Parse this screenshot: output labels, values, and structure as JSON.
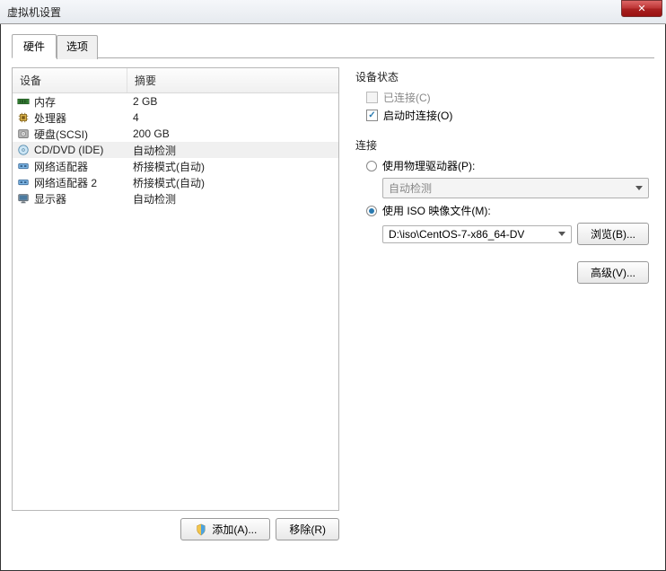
{
  "window": {
    "title": "虚拟机设置",
    "close_glyph": "✕"
  },
  "tabs": [
    {
      "label": "硬件",
      "active": true
    },
    {
      "label": "选项",
      "active": false
    }
  ],
  "hw_header": {
    "device": "设备",
    "summary": "摘要"
  },
  "hw_rows": [
    {
      "icon": "memory-icon",
      "device": "内存",
      "summary": "2 GB",
      "selected": false
    },
    {
      "icon": "cpu-icon",
      "device": "处理器",
      "summary": "4",
      "selected": false
    },
    {
      "icon": "disk-icon",
      "device": "硬盘(SCSI)",
      "summary": "200 GB",
      "selected": false
    },
    {
      "icon": "cd-icon",
      "device": "CD/DVD (IDE)",
      "summary": "自动检测",
      "selected": true
    },
    {
      "icon": "network-icon",
      "device": "网络适配器",
      "summary": "桥接模式(自动)",
      "selected": false
    },
    {
      "icon": "network-icon",
      "device": "网络适配器 2",
      "summary": "桥接模式(自动)",
      "selected": false
    },
    {
      "icon": "display-icon",
      "device": "显示器",
      "summary": "自动检测",
      "selected": false
    }
  ],
  "buttons": {
    "add": "添加(A)...",
    "remove": "移除(R)"
  },
  "status": {
    "title": "设备状态",
    "connected": {
      "label": "已连接(C)",
      "checked": false,
      "enabled": false
    },
    "connect_on": {
      "label": "启动时连接(O)",
      "checked": true,
      "enabled": true
    }
  },
  "connection": {
    "title": "连接",
    "physical": {
      "label": "使用物理驱动器(P):",
      "selected": false,
      "dropdown": "自动检测"
    },
    "iso": {
      "label": "使用 ISO 映像文件(M):",
      "selected": true,
      "path": "D:\\iso\\CentOS-7-x86_64-DV",
      "browse": "浏览(B)..."
    }
  },
  "advanced": "高级(V)..."
}
